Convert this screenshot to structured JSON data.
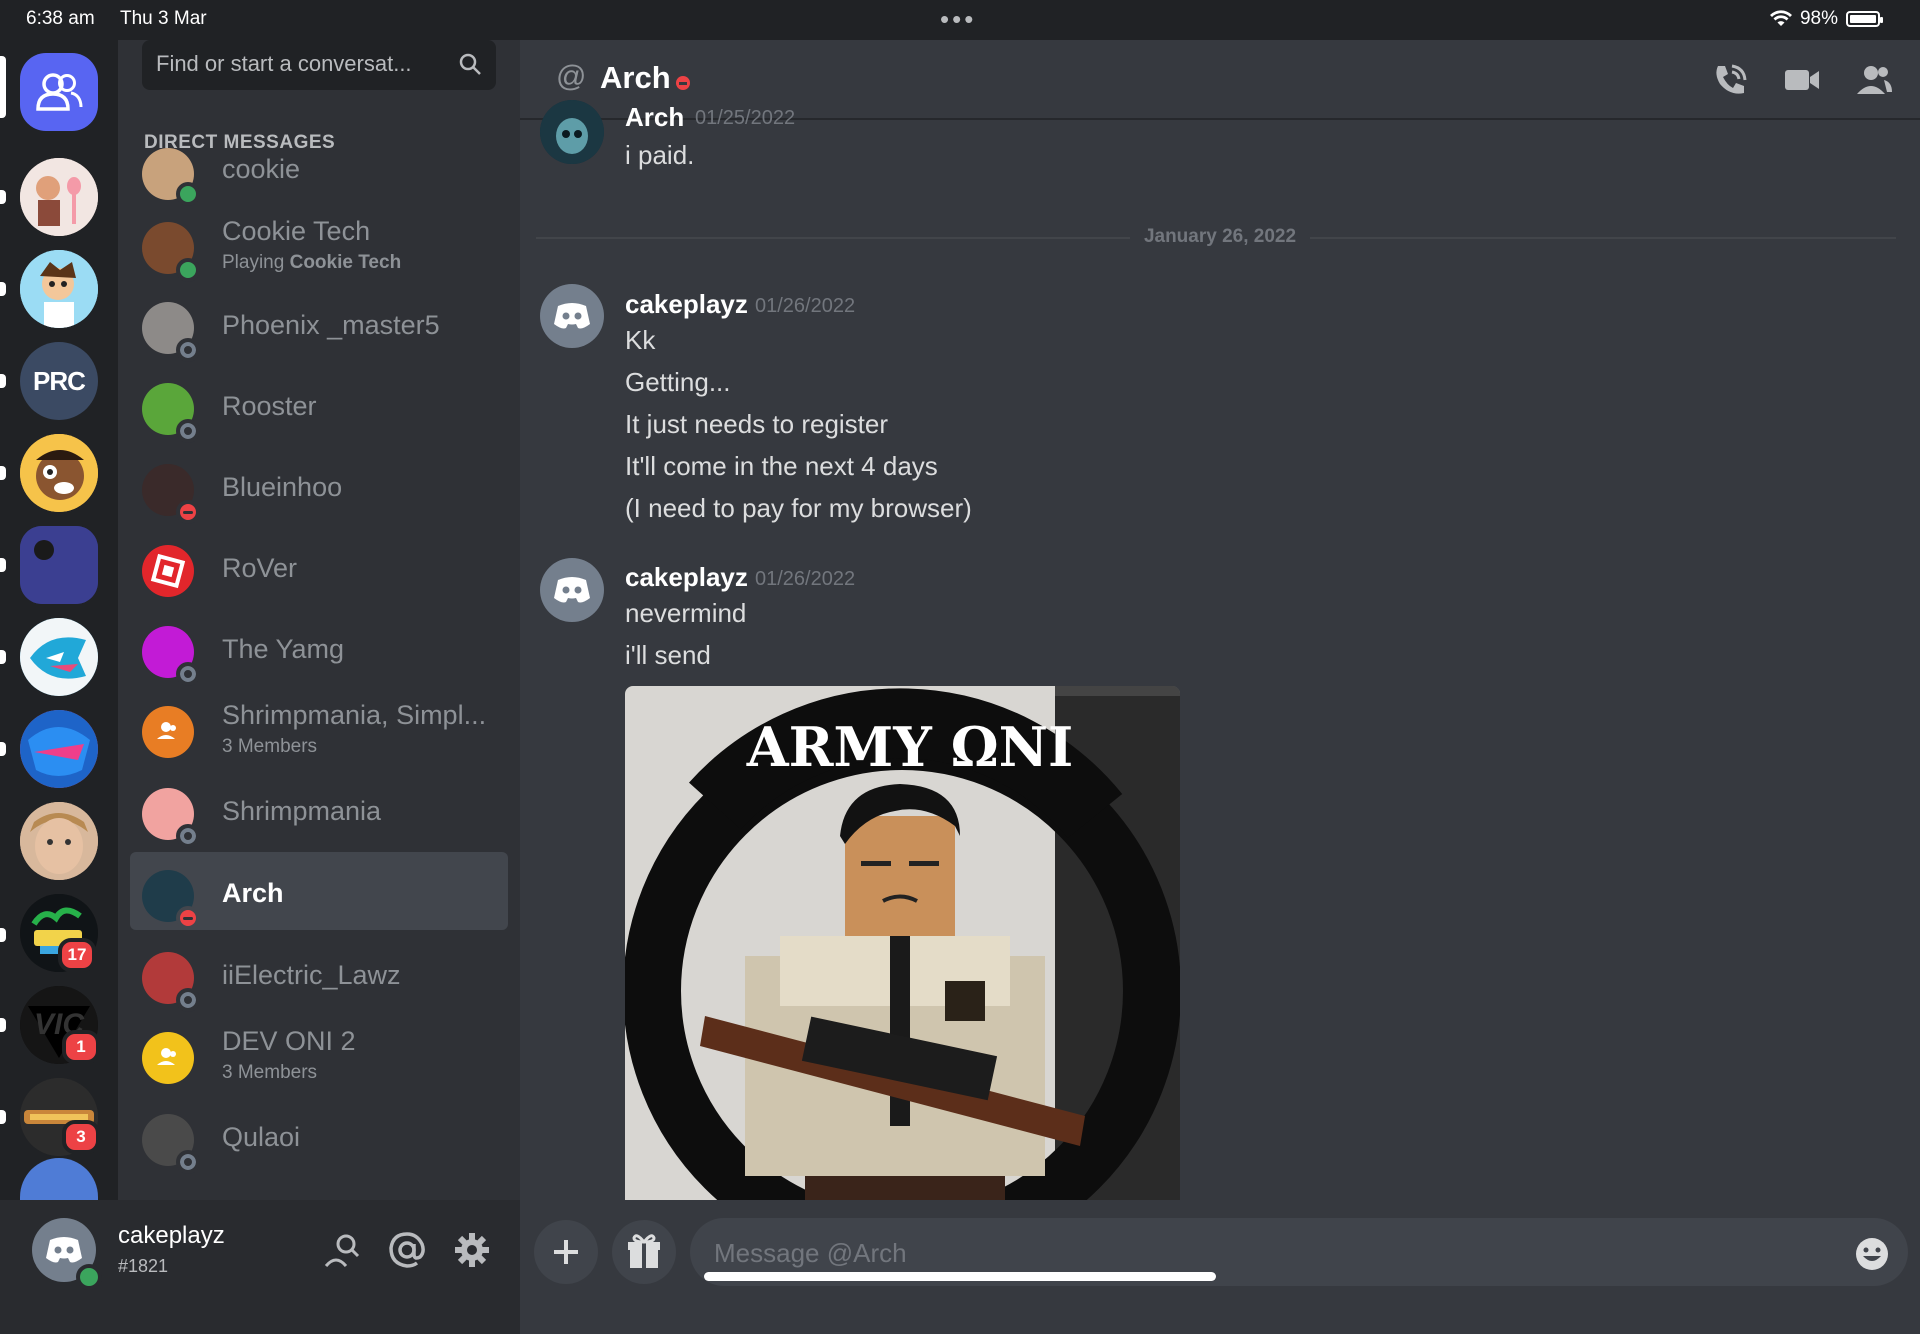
{
  "status_bar": {
    "time": "6:38 am",
    "date": "Thu 3 Mar",
    "battery": "98%"
  },
  "servers": [
    {
      "id": "home",
      "badge": ""
    },
    {
      "id": "server-1",
      "badge": ""
    },
    {
      "id": "server-2",
      "badge": ""
    },
    {
      "id": "server-prc",
      "label": "PRC",
      "badge": ""
    },
    {
      "id": "server-4",
      "badge": ""
    },
    {
      "id": "server-5",
      "badge": ""
    },
    {
      "id": "server-6",
      "badge": ""
    },
    {
      "id": "server-7",
      "badge": ""
    },
    {
      "id": "server-8",
      "badge": ""
    },
    {
      "id": "server-sandy",
      "badge": "17"
    },
    {
      "id": "server-vic",
      "label": "VIC",
      "badge": "1"
    },
    {
      "id": "server-studios",
      "badge": "3"
    }
  ],
  "sidebar": {
    "search_placeholder": "Find or start a conversat...",
    "header": "DIRECT MESSAGES",
    "dms": [
      {
        "name": "cookie",
        "status": "online"
      },
      {
        "name": "Cookie Tech",
        "sub_prefix": "Playing ",
        "sub_bold": "Cookie Tech",
        "status": "online"
      },
      {
        "name": "Phoenix _master5",
        "status": "offline"
      },
      {
        "name": "Rooster",
        "status": "offline"
      },
      {
        "name": "Blueinhoo",
        "status": "dnd"
      },
      {
        "name": "RoVer",
        "status": "none"
      },
      {
        "name": "The Yamg",
        "status": "offline"
      },
      {
        "name": "Shrimpmania, Simpl...",
        "sub": "3 Members",
        "status": "none"
      },
      {
        "name": "Shrimpmania",
        "status": "offline"
      },
      {
        "name": "Arch",
        "status": "dnd",
        "active": true
      },
      {
        "name": "iiElectric_Lawz",
        "status": "offline"
      },
      {
        "name": "DEV ONI 2",
        "sub": "3 Members",
        "status": "none"
      },
      {
        "name": "Qulaoi",
        "status": "offline"
      }
    ]
  },
  "user": {
    "name": "cakeplayz",
    "tag": "#1821"
  },
  "chat": {
    "at_symbol": "@",
    "title": "Arch",
    "messages": [
      {
        "author": "Arch",
        "time": "01/25/2022",
        "lines": [
          "i paid."
        ]
      },
      {
        "author": "cakeplayz",
        "time": "01/26/2022",
        "lines": [
          "Kk",
          "Getting...",
          "It just needs to register",
          "It'll come in the next 4 days",
          "(I need to pay for my browser)"
        ]
      },
      {
        "author": "cakeplayz",
        "time": "01/26/2022",
        "lines": [
          "nevermind",
          "i'll send"
        ]
      }
    ],
    "date_divider": "January 26, 2022",
    "attachment_text": "ARMY ΩNI",
    "composer_placeholder": "Message @Arch"
  },
  "colors": {
    "online": "#3ba55d",
    "dnd": "#ed4245",
    "blurple": "#5865f2",
    "badge": "#ed4245"
  }
}
